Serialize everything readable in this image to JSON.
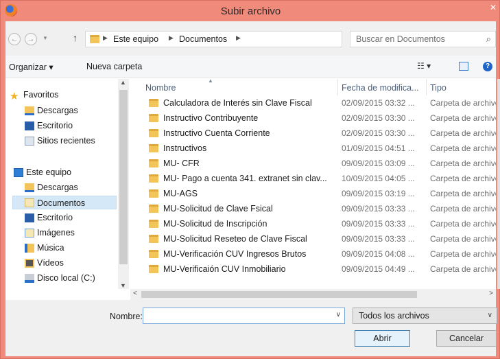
{
  "window": {
    "title": "Subir archivo",
    "close_glyph": "✕"
  },
  "address": {
    "crumbs": [
      "Este equipo",
      "Documentos"
    ],
    "search_placeholder": "Buscar en Documentos"
  },
  "toolbar": {
    "organize_label": "Organizar ▾",
    "new_folder_label": "Nueva carpeta"
  },
  "nav": {
    "favorites_label": "Favoritos",
    "favorites": [
      "Descargas",
      "Escritorio",
      "Sitios recientes"
    ],
    "this_pc_label": "Este equipo",
    "this_pc": [
      "Descargas",
      "Documentos",
      "Escritorio",
      "Imágenes",
      "Música",
      "Vídeos",
      "Disco local (C:)"
    ],
    "selected": "Documentos"
  },
  "list": {
    "columns": [
      "Nombre",
      "Fecha de modifica...",
      "Tipo"
    ],
    "rows": [
      {
        "name": "Calculadora de Interés sin Clave Fiscal",
        "date": "02/09/2015 03:32 ...",
        "type": "Carpeta de archivos"
      },
      {
        "name": "Instructivo Contribuyente",
        "date": "02/09/2015 03:30 ...",
        "type": "Carpeta de archivos"
      },
      {
        "name": "Instructivo Cuenta Corriente",
        "date": "02/09/2015 03:30 ...",
        "type": "Carpeta de archivos"
      },
      {
        "name": "Instructivos",
        "date": "01/09/2015 04:51 ...",
        "type": "Carpeta de archivos"
      },
      {
        "name": "MU- CFR",
        "date": "09/09/2015 03:09 ...",
        "type": "Carpeta de archivos"
      },
      {
        "name": "MU- Pago a cuenta 341. extranet sin clav...",
        "date": "10/09/2015 04:05 ...",
        "type": "Carpeta de archivos"
      },
      {
        "name": "MU-AGS",
        "date": "09/09/2015 03:19 ...",
        "type": "Carpeta de archivos"
      },
      {
        "name": "MU-Solicitud de Clave Fsical",
        "date": "09/09/2015 03:33 ...",
        "type": "Carpeta de archivos"
      },
      {
        "name": "MU-Solicitud de Inscripción",
        "date": "09/09/2015 03:33 ...",
        "type": "Carpeta de archivos"
      },
      {
        "name": "MU-Solicitud Reseteo de Clave Fiscal",
        "date": "09/09/2015 03:33 ...",
        "type": "Carpeta de archivos"
      },
      {
        "name": "MU-Verificación CUV Ingresos Brutos",
        "date": "09/09/2015 04:08 ...",
        "type": "Carpeta de archivos"
      },
      {
        "name": "MU-Verificaión CUV Inmobiliario",
        "date": "09/09/2015 04:49 ...",
        "type": "Carpeta de archivos"
      }
    ]
  },
  "footer": {
    "filename_label": "Nombre:",
    "filename_value": "",
    "filter_label": "Todos los archivos",
    "open_label": "Abrir",
    "cancel_label": "Cancelar"
  },
  "colors": {
    "title_bar": "#f08a7a",
    "selection": "#d5e8f8",
    "folder": "#f2c45a"
  }
}
